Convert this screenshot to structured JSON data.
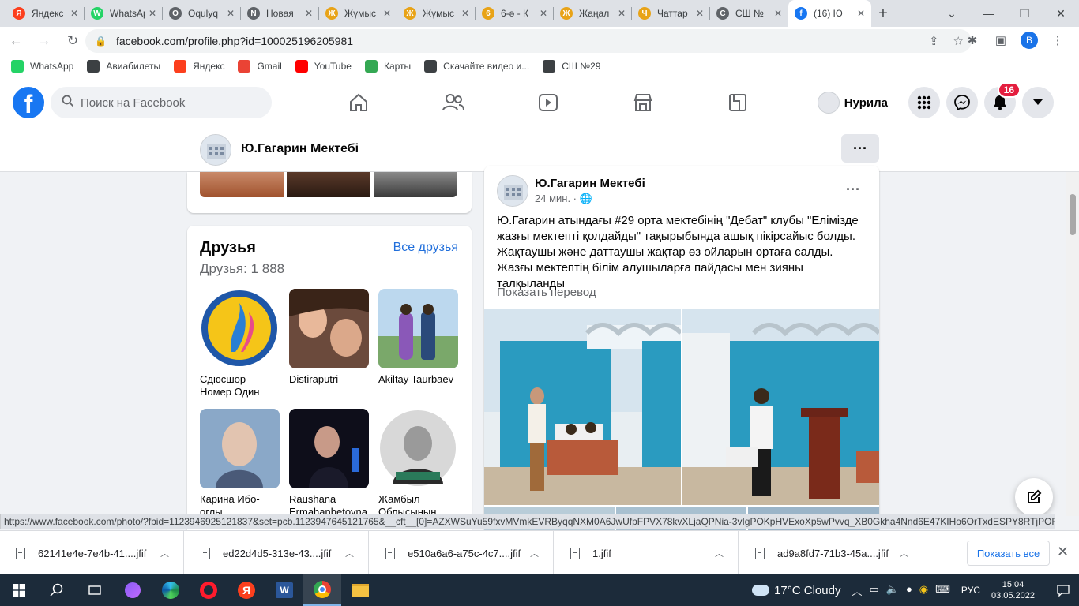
{
  "browser": {
    "tabs": [
      {
        "label": "Яндекс",
        "color": "#fc3f1d",
        "glyph": "Я"
      },
      {
        "label": "WhatsApp",
        "color": "#25d366",
        "glyph": "W"
      },
      {
        "label": "Oqulyq",
        "color": "#5f6368",
        "glyph": "O"
      },
      {
        "label": "Новая",
        "color": "#5f6368",
        "glyph": "N"
      },
      {
        "label": "Жұмыс",
        "color": "#e8a317",
        "glyph": "Ж"
      },
      {
        "label": "Жұмыс",
        "color": "#e8a317",
        "glyph": "Ж"
      },
      {
        "label": "6-ә - К",
        "color": "#e8a317",
        "glyph": "6"
      },
      {
        "label": "Жаңал",
        "color": "#e8a317",
        "glyph": "Ж"
      },
      {
        "label": "Чаттар",
        "color": "#e8a317",
        "glyph": "Ч"
      },
      {
        "label": "СШ №",
        "color": "#5f6368",
        "glyph": "С"
      },
      {
        "label": "(16) Ю",
        "color": "#1877f2",
        "glyph": "f",
        "active": true
      }
    ],
    "address": "facebook.com/profile.php?id=100025196205981",
    "profile_initial": "B",
    "bookmarks": [
      {
        "label": "WhatsApp",
        "color": "#25d366"
      },
      {
        "label": "Авиабилеты",
        "color": "#3c4043"
      },
      {
        "label": "Яндекс",
        "color": "#fc3f1d"
      },
      {
        "label": "Gmail",
        "color": "#ea4335"
      },
      {
        "label": "YouTube",
        "color": "#ff0000"
      },
      {
        "label": "Карты",
        "color": "#34a853"
      },
      {
        "label": "Скачайте видео и...",
        "color": "#3c4043"
      },
      {
        "label": "СШ №29",
        "color": "#3c4043"
      }
    ]
  },
  "facebook": {
    "logo": "f",
    "search_placeholder": "Поиск на Facebook",
    "user_name": "Нурила",
    "notifications_count": "16",
    "profile_name": "Ю.Гагарин Мектебі",
    "more_label": "···"
  },
  "friends": {
    "title": "Друзья",
    "all_link": "Все друзья",
    "count": "Друзья: 1 888",
    "items": [
      {
        "name": "Сдюсшор Номер Один"
      },
      {
        "name": "Distiraputri"
      },
      {
        "name": "Akiltay Taurbaev"
      },
      {
        "name": "Карина Ибо-оглы"
      },
      {
        "name": "Raushana Ermahanbetovna"
      },
      {
        "name": "Жамбыл Облысының"
      }
    ]
  },
  "post": {
    "author": "Ю.Гагарин Мектебі",
    "time": "24 мин. · ",
    "text": "Ю.Гагарин атындағы #29 орта мектебінің \"Дебат\" клубы \"Елімізде жазғы мектепті қолдайды\" тақырыбында ашық пікірсайыс болды. Жақтаушы және даттаушы жақтар өз ойларын ортаға салды. Жазғы мектептің білім алушыларға пайдасы мен зияны талқыланды",
    "translate": "Показать перевод"
  },
  "status_url": "https://www.facebook.com/photo/?fbid=1123946925121837&set=pcb.1123947645121765&__cft__[0]=AZXWSuYu59fxvMVmkEVRByqqNXM0A6JwUfpFPVX78kvXLjaQPNia-3vIgPOKpHVExoXp5wPvvq_XB0Gkha4Nnd6E47KIHo6OrTxdESPY8RTjPORW-P...",
  "downloads": {
    "items": [
      {
        "name": "62141e4e-7e4b-41....jfif"
      },
      {
        "name": "ed22d4d5-313e-43....jfif"
      },
      {
        "name": "e510a6a6-a75c-4c7....jfif"
      },
      {
        "name": "1.jfif"
      },
      {
        "name": "ad9a8fd7-71b3-45a....jfif"
      }
    ],
    "show_all": "Показать все"
  },
  "taskbar": {
    "weather": "17°C  Cloudy",
    "lang": "РУС",
    "time": "15:04",
    "date": "03.05.2022"
  }
}
